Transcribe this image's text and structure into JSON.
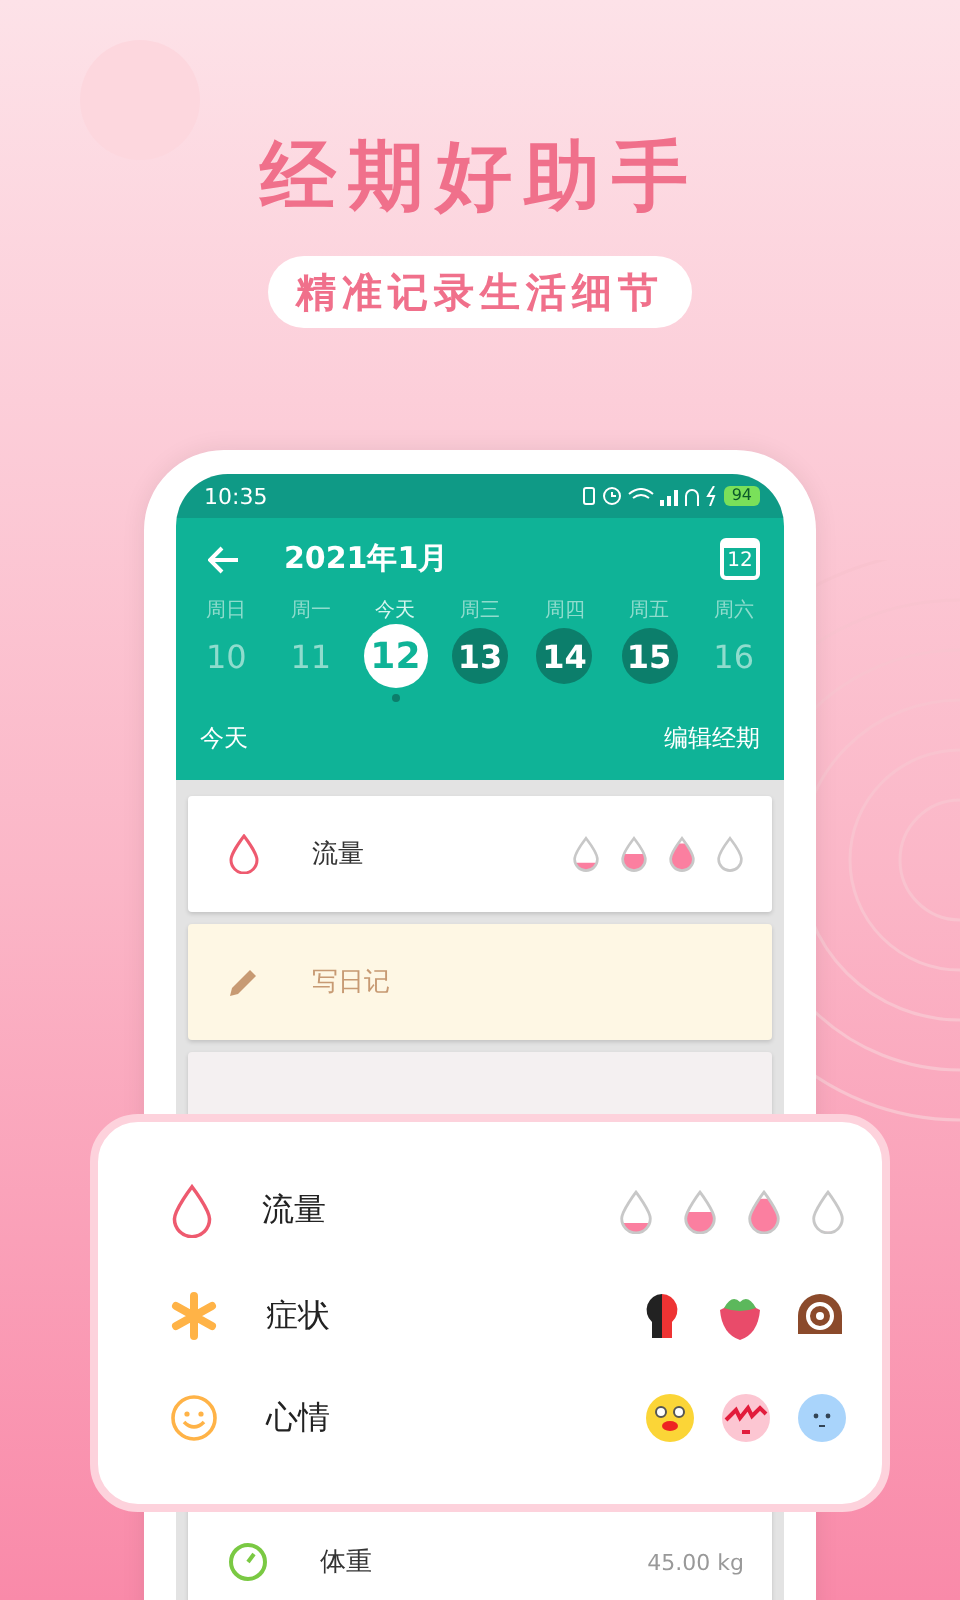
{
  "headline": "经期好助手",
  "tagline": "精准记录生活细节",
  "status_bar": {
    "time": "10:35",
    "battery": "94"
  },
  "app_bar": {
    "title": "2021年1月",
    "calendar_day": "12"
  },
  "week": [
    {
      "weekday": "周日",
      "day": "10",
      "kind": "plain",
      "selected": false,
      "has_record": false
    },
    {
      "weekday": "周一",
      "day": "11",
      "kind": "plain",
      "selected": false,
      "has_record": false
    },
    {
      "weekday": "今天",
      "day": "12",
      "kind": "plain",
      "selected": true,
      "has_record": true
    },
    {
      "weekday": "周三",
      "day": "13",
      "kind": "period",
      "selected": false,
      "has_record": false
    },
    {
      "weekday": "周四",
      "day": "14",
      "kind": "period",
      "selected": false,
      "has_record": false
    },
    {
      "weekday": "周五",
      "day": "15",
      "kind": "period",
      "selected": false,
      "has_record": false
    },
    {
      "weekday": "周六",
      "day": "16",
      "kind": "plain",
      "selected": false,
      "has_record": false
    }
  ],
  "today_link": "今天",
  "edit_button": "编辑经期",
  "records": [
    {
      "kind": "flow",
      "label": "流量",
      "drops": [
        {
          "level": 0.25
        },
        {
          "level": 0.5
        },
        {
          "level": 0.8
        },
        {
          "level": 0
        }
      ]
    },
    {
      "kind": "diary",
      "label": "写日记"
    }
  ],
  "weight": {
    "label": "体重",
    "value": "45.00 kg"
  },
  "popup": [
    {
      "kind": "flow",
      "label": "流量",
      "drops": [
        {
          "level": 0.25
        },
        {
          "level": 0.5
        },
        {
          "level": 0.8
        },
        {
          "level": 0
        }
      ]
    },
    {
      "kind": "symptom",
      "label": "症状"
    },
    {
      "kind": "mood",
      "label": "心情"
    }
  ]
}
